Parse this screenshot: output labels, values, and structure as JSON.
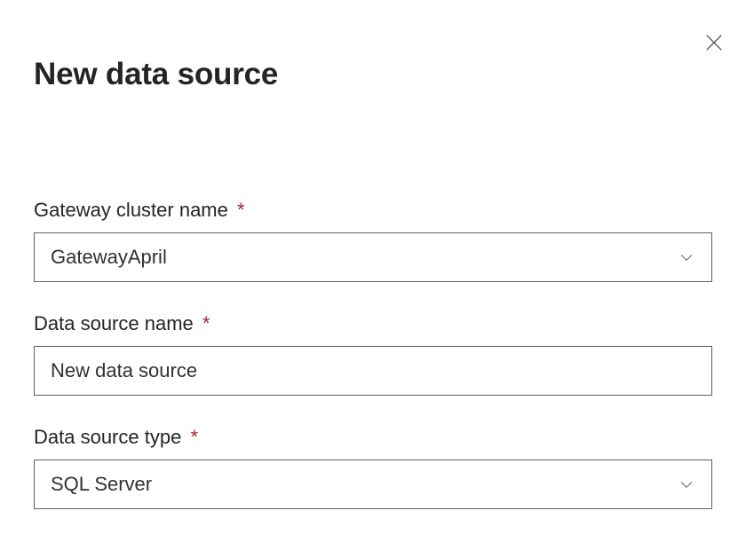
{
  "dialog": {
    "title": "New data source"
  },
  "form": {
    "gateway_cluster": {
      "label": "Gateway cluster name",
      "value": "GatewayApril"
    },
    "data_source_name": {
      "label": "Data source name",
      "value": "New data source"
    },
    "data_source_type": {
      "label": "Data source type",
      "value": "SQL Server"
    },
    "required_mark": "*"
  }
}
